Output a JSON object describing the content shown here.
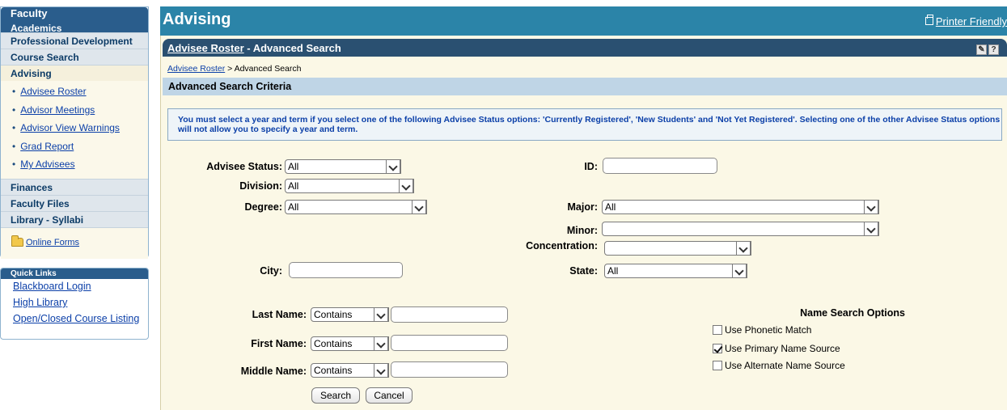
{
  "sidebar": {
    "title": "Faculty",
    "sections": {
      "academics": "Academics",
      "professional_development": "Professional Development",
      "course_search": "Course Search",
      "advising": "Advising",
      "finances": "Finances",
      "faculty_files": "Faculty Files",
      "library_syllabi": "Library - Syllabi"
    },
    "advising_items": [
      "Advisee Roster",
      "Advisor Meetings",
      "Advisor View Warnings",
      "Grad Report",
      "My Advisees"
    ],
    "online_forms": "Online Forms"
  },
  "quick_links": {
    "title": "Quick Links",
    "items": [
      "Blackboard Login",
      "High Library",
      "Open/Closed Course Listing"
    ]
  },
  "header": {
    "title": "Advising",
    "printer_friendly": "Printer Friendly"
  },
  "panel": {
    "link": "Advisee Roster",
    "suffix": " - Advanced Search",
    "breadcrumb_link": "Advisee Roster",
    "breadcrumb_rest": " > Advanced Search",
    "criteria_title": "Advanced Search Criteria",
    "notice": "You must select a year and term if you select one of the following Advisee Status options: 'Currently Registered', 'New Students' and 'Not Yet Registered'. Selecting one of the other Advisee Status options will not allow you to specify a year and term."
  },
  "form": {
    "advisee_status": {
      "label": "Advisee Status:",
      "value": "All"
    },
    "id": {
      "label": "ID:",
      "value": ""
    },
    "division": {
      "label": "Division:",
      "value": "All"
    },
    "degree": {
      "label": "Degree:",
      "value": "All"
    },
    "major": {
      "label": "Major:",
      "value": "All"
    },
    "minor": {
      "label": "Minor:",
      "value": ""
    },
    "concentration": {
      "label": "Concentration:",
      "value": ""
    },
    "city": {
      "label": "City:",
      "value": ""
    },
    "state": {
      "label": "State:",
      "value": "All"
    },
    "last_name": {
      "label": "Last Name:",
      "mode": "Contains",
      "value": ""
    },
    "first_name": {
      "label": "First Name:",
      "mode": "Contains",
      "value": ""
    },
    "middle_name": {
      "label": "Middle Name:",
      "mode": "Contains",
      "value": ""
    },
    "name_options": {
      "title": "Name Search Options",
      "phonetic": "Use Phonetic Match",
      "primary": "Use Primary Name Source",
      "alternate": "Use Alternate Name Source",
      "primary_checked": true
    },
    "search_button": "Search",
    "cancel_button": "Cancel"
  }
}
